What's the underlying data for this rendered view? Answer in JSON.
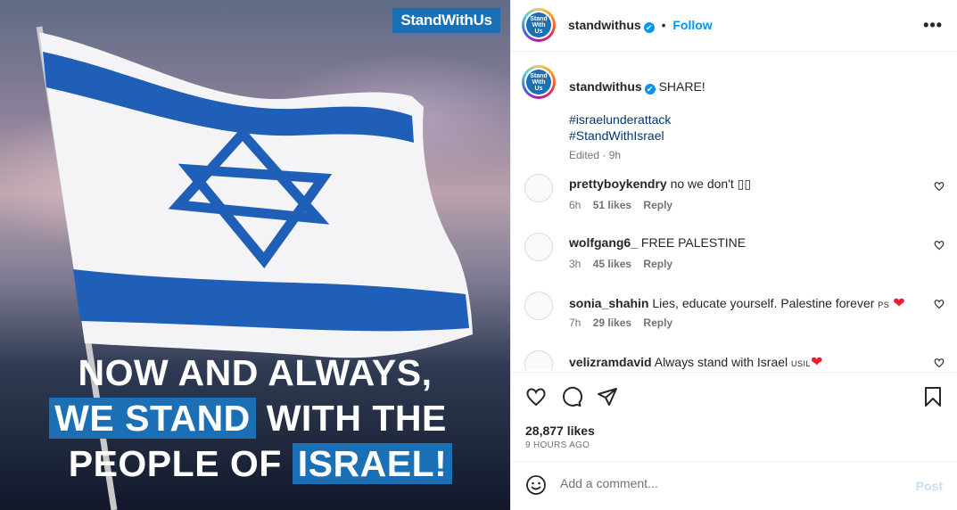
{
  "media": {
    "brand_badge": "StandWithUs",
    "headline": {
      "line1": "NOW AND ALWAYS,",
      "line2_highlight": "WE STAND",
      "line2_rest": " WITH THE",
      "line3_rest": "PEOPLE OF ",
      "line3_highlight": "ISRAEL!"
    },
    "flag_color": "#1f5fb8",
    "badge_color": "#1a6fb5"
  },
  "header": {
    "avatar_logo": [
      "Stand",
      "With",
      "Us"
    ],
    "username": "standwithus",
    "verified_icon": "✔",
    "separator": "•",
    "follow_label": "Follow",
    "more_icon": "•••"
  },
  "caption": {
    "username": "standwithus",
    "text": "SHARE!",
    "hashtags": [
      "#israelunderattack",
      "#StandWithIsrael"
    ],
    "edited": "Edited · 9h"
  },
  "comments": [
    {
      "username": "prettyboykendry",
      "text": "no we don't ",
      "suffix": "▯▯",
      "time": "6h",
      "likes": "51 likes",
      "reply": "Reply"
    },
    {
      "username": "wolfgang6_",
      "text": "FREE PALESTINE",
      "suffix": "",
      "time": "3h",
      "likes": "45 likes",
      "reply": "Reply"
    },
    {
      "username": "sonia_shahin",
      "text": "Lies, educate yourself. Palestine forever ",
      "flag": "PS",
      "heart": "❤",
      "time": "7h",
      "likes": "29 likes",
      "reply": "Reply"
    },
    {
      "username": "velizramdavid",
      "text": "Always stand with Israel ",
      "flag": "USIL",
      "heart": "❤",
      "time": "",
      "likes": "",
      "reply": ""
    }
  ],
  "actions": {
    "likes": "28,877 likes",
    "posted": "9 HOURS AGO"
  },
  "add_comment": {
    "placeholder": "Add a comment...",
    "post_label": "Post"
  },
  "colors": {
    "link_blue": "#0095f6",
    "hashtag": "#00376b",
    "post_disabled": "#c0dffd"
  }
}
